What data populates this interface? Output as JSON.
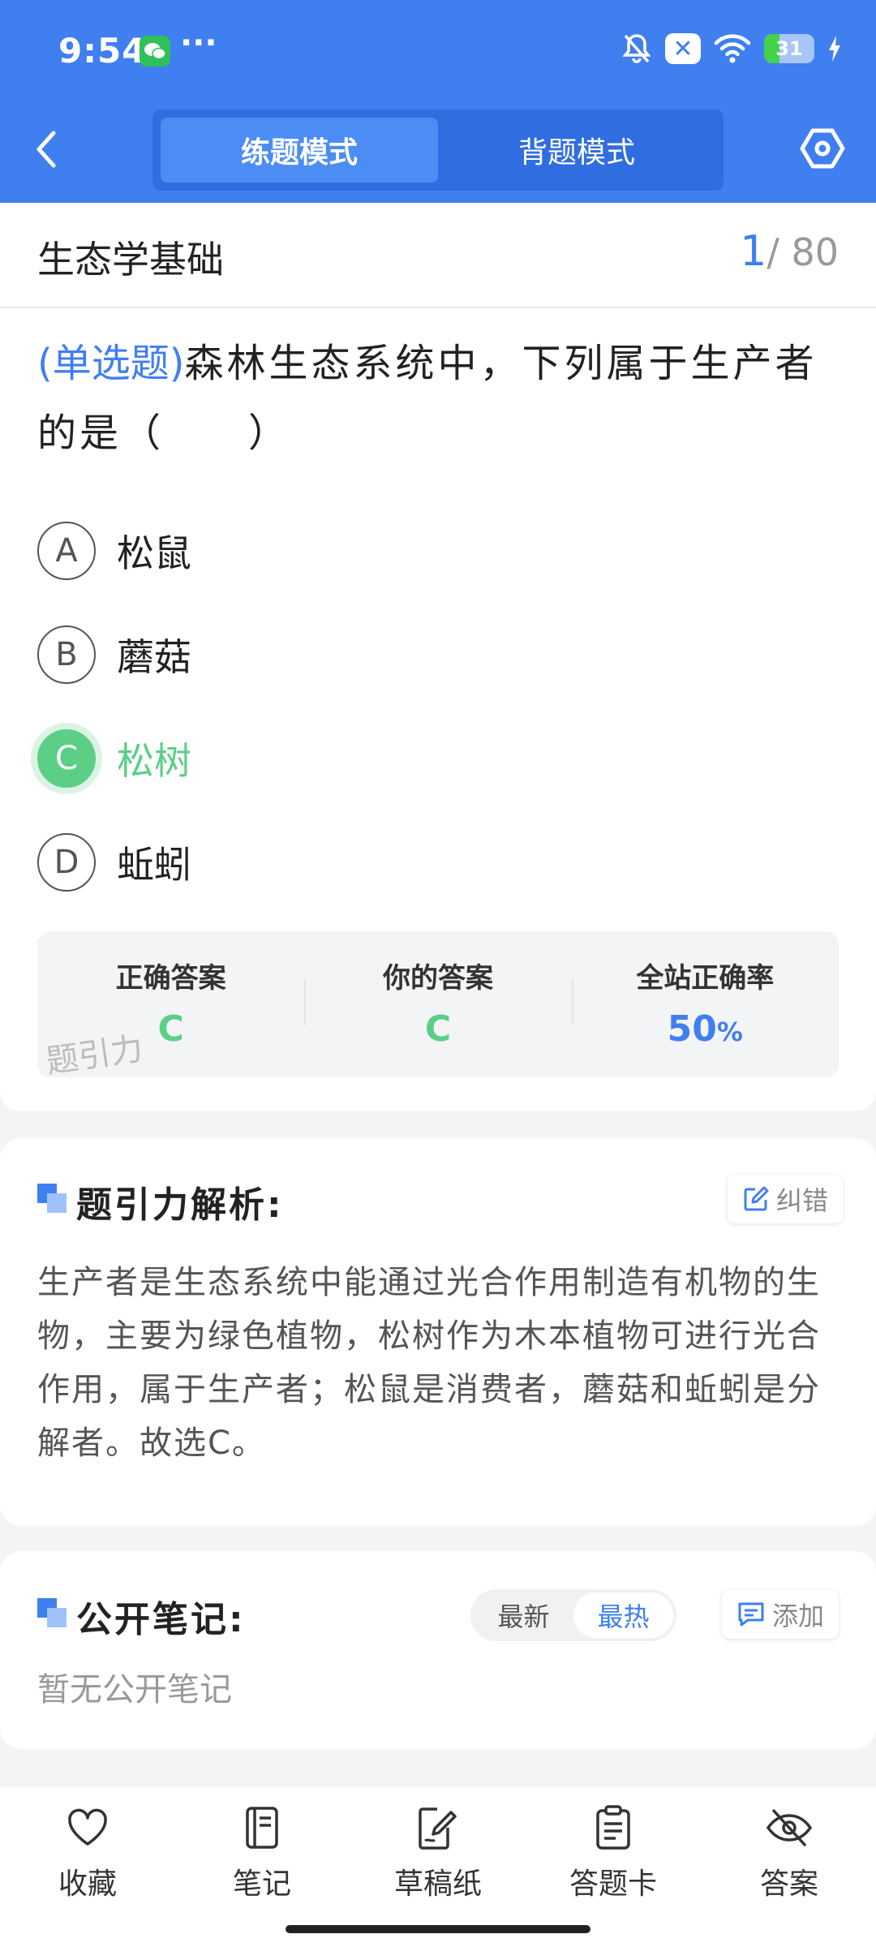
{
  "status_bar": {
    "time": "9:54",
    "battery": "31",
    "battery_level": 0.31
  },
  "header": {
    "tabs": [
      {
        "label": "练题模式",
        "active": true
      },
      {
        "label": "背题模式",
        "active": false
      }
    ]
  },
  "subject": {
    "title": "生态学基础",
    "current": "1",
    "total": "/ 80"
  },
  "question": {
    "type": "(单选题)",
    "text": "森林生态系统中，下列属于生产者的是（　　）",
    "options": [
      {
        "letter": "A",
        "text": "松鼠"
      },
      {
        "letter": "B",
        "text": "蘑菇"
      },
      {
        "letter": "C",
        "text": "松树"
      },
      {
        "letter": "D",
        "text": "蚯蚓"
      }
    ]
  },
  "answers": {
    "correct_label": "正确答案",
    "correct_value": "C",
    "yours_label": "你的答案",
    "yours_value": "C",
    "rate_label": "全站正确率",
    "rate_value": "50",
    "rate_unit": "%",
    "watermark": "题引力"
  },
  "analysis": {
    "title": "题引力解析:",
    "correct_button": "纠错",
    "text": "生产者是生态系统中能通过光合作用制造有机物的生物，主要为绿色植物，松树作为木本植物可进行光合作用，属于生产者；松鼠是消费者，蘑菇和蚯蚓是分解者。故选C。"
  },
  "notes": {
    "title": "公开笔记:",
    "sort_latest": "最新",
    "sort_hot": "最热",
    "add_button": "添加",
    "empty": "暂无公开笔记"
  },
  "bottom_bar": {
    "favorite": "收藏",
    "note": "笔记",
    "draft": "草稿纸",
    "answer_card": "答题卡",
    "answer": "答案"
  },
  "colors": {
    "primary": "#3f7ff0",
    "correct": "#5ccf86"
  }
}
